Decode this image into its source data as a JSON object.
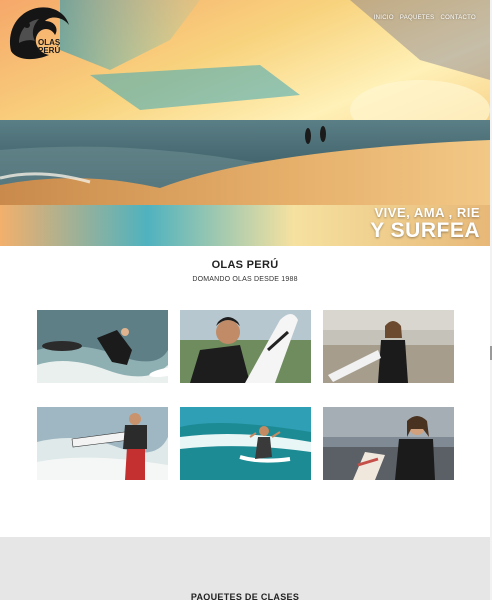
{
  "brand": {
    "logo_line1": "OLAS",
    "logo_line2": "PERÚ"
  },
  "nav": {
    "items": [
      "INICIO",
      "PAQUETES",
      "CONTACTO"
    ]
  },
  "hero": {
    "slogan_line1": "VIVE, AMA , RIE",
    "slogan_line2": "Y SURFEA"
  },
  "about": {
    "title": "OLAS PERÚ",
    "subtitle": "DOMANDO OLAS DESDE 1988"
  },
  "gallery": [
    {
      "name": "photo-surfer-crouching"
    },
    {
      "name": "photo-surfer-with-board"
    },
    {
      "name": "photo-woman-wetsuit-beach"
    },
    {
      "name": "photo-woman-carrying-board"
    },
    {
      "name": "photo-surfer-riding-wave"
    },
    {
      "name": "photo-woman-board-promenade"
    }
  ],
  "packages": {
    "title": "PAQUETES DE CLASES"
  },
  "colors": {
    "sky": "#f4c56c",
    "sea": "#3e8fa6",
    "sand": "#d9a25a",
    "grey_band": "#e6e6e6"
  }
}
